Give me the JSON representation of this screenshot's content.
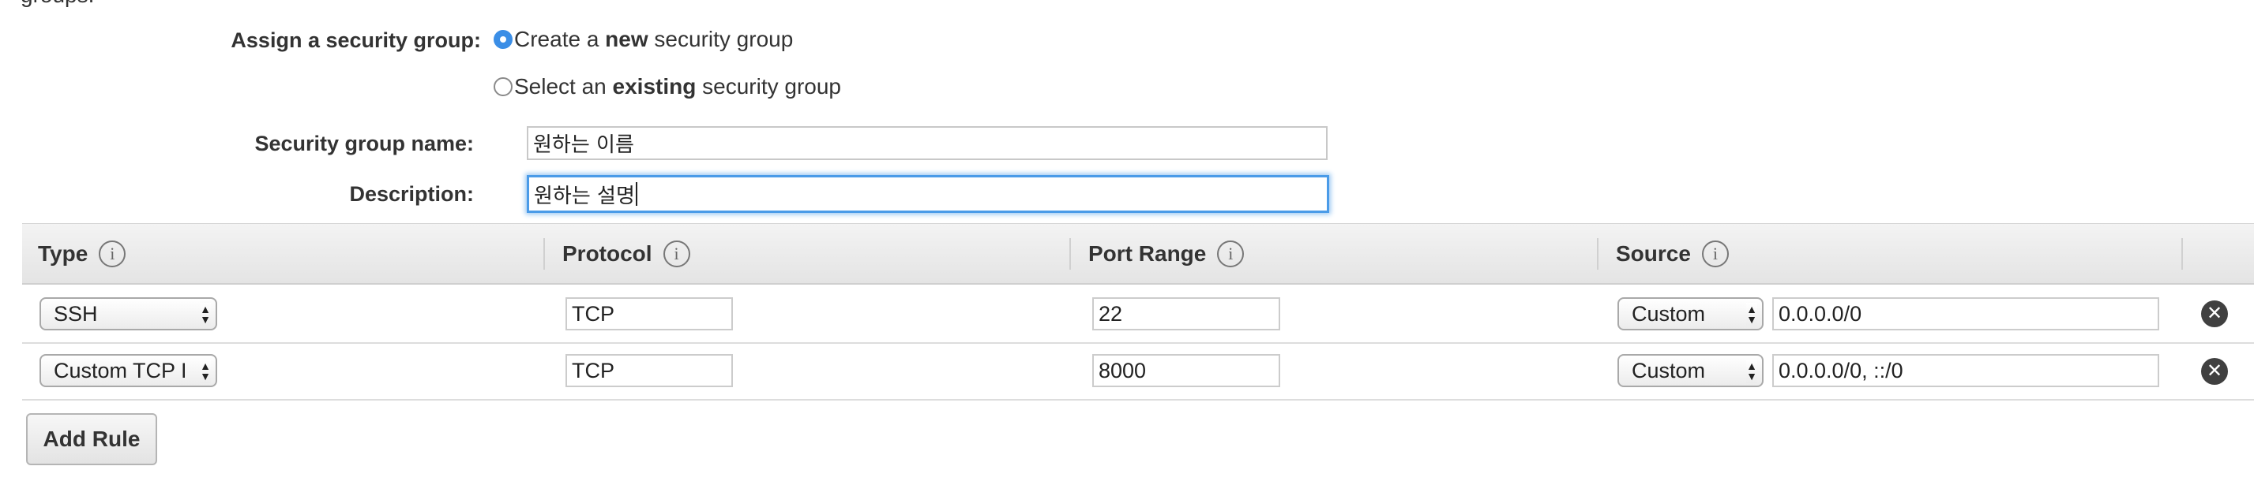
{
  "cutoff_text": "groups.",
  "assign": {
    "label": "Assign a security group:",
    "option_new_prefix": "Create a ",
    "option_new_bold": "new",
    "option_new_suffix": " security group",
    "option_existing_prefix": "Select an ",
    "option_existing_bold": "existing",
    "option_existing_suffix": " security group",
    "selected": "new"
  },
  "group_name": {
    "label": "Security group name:",
    "value": "원하는 이름"
  },
  "description": {
    "label": "Description:",
    "value": "원하는 설명"
  },
  "table": {
    "columns": [
      {
        "label": "Type",
        "info_icon": "info-icon"
      },
      {
        "label": "Protocol",
        "info_icon": "info-icon"
      },
      {
        "label": "Port Range",
        "info_icon": "info-icon"
      },
      {
        "label": "Source",
        "info_icon": "info-icon"
      }
    ],
    "rows": [
      {
        "type": "SSH",
        "protocol": "TCP",
        "port_range": "22",
        "source_type": "Custom",
        "source_value": "0.0.0.0/0"
      },
      {
        "type": "Custom TCP I",
        "protocol": "TCP",
        "port_range": "8000",
        "source_type": "Custom",
        "source_value": "0.0.0.0/0, ::/0"
      }
    ],
    "info_glyph": "i",
    "remove_icon": "close-circle-icon",
    "remove_glyph": "✕",
    "select_arrow_up": "▲",
    "select_arrow_down": "▼"
  },
  "add_rule_label": "Add Rule",
  "colors": {
    "accent": "#3b8ee6",
    "focus_border": "#4a9be8"
  }
}
